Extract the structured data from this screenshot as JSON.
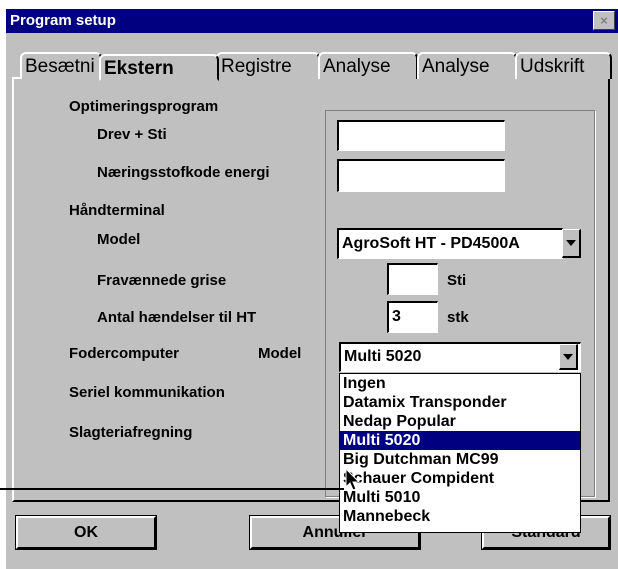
{
  "window": {
    "title": "Program setup",
    "close_glyph": "×"
  },
  "tabs": [
    {
      "label": "Besætni",
      "active": false
    },
    {
      "label": "Ekstern",
      "active": true
    },
    {
      "label": "Registre",
      "active": false
    },
    {
      "label": "Analyse",
      "active": false
    },
    {
      "label": "Analyse",
      "active": false
    },
    {
      "label": "Udskrift",
      "active": false
    }
  ],
  "form": {
    "optimering_heading": "Optimeringsprogram",
    "drev_label": "Drev + Sti",
    "drev_value": "",
    "naering_label": "Næringsstofkode energi",
    "naering_value": "",
    "haandterminal_heading": "Håndterminal",
    "model_label": "Model",
    "model_value": "AgroSoft HT - PD4500A",
    "fravaennede_label": "Fravænnede grise",
    "fravaennede_value": "",
    "fravaennede_unit": "Sti",
    "antal_label": "Antal hændelser til HT",
    "antal_value": "3",
    "antal_unit": "stk",
    "fodercomputer_label": "Fodercomputer",
    "fodercomputer_model_label": "Model",
    "fodercomputer_value": "Multi 5020",
    "seriel_label": "Seriel kommunikation",
    "slagteri_label": "Slagteriafregning"
  },
  "dropdown_options": [
    "Ingen",
    "Datamix Transponder",
    "Nedap Popular",
    "Multi 5020",
    "Big Dutchman MC99",
    "Schauer Compident",
    "Multi 5010",
    "Mannebeck"
  ],
  "dropdown_selected_index": 3,
  "buttons": {
    "ok": "OK",
    "annuller": "Annuller",
    "standard": "Standard"
  },
  "colors": {
    "titlebar": "#000080",
    "face": "#c0c0c0",
    "highlight": "#000080"
  },
  "icons": {
    "close": "close-icon",
    "dropdown": "chevron-down-icon",
    "pointer": "mouse-cursor-icon"
  }
}
